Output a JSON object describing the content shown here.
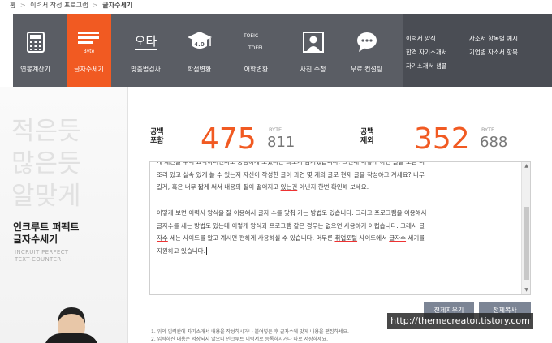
{
  "breadcrumb": [
    "홈",
    "이력서 작성 프로그램",
    "글자수세기"
  ],
  "breadcrumb_sep": ">",
  "nav": {
    "items": [
      {
        "label": "연봉계산기",
        "icon": "calculator-icon"
      },
      {
        "label": "글자수세기",
        "icon": "byte-lines-icon",
        "icon_text": "Byte",
        "active": true
      },
      {
        "label": "맞춤법검사",
        "icon": "spellcheck-icon",
        "icon_text": "오타"
      },
      {
        "label": "학점변환",
        "icon": "grad-cap-icon",
        "icon_text": "4.0"
      },
      {
        "label": "어학변환",
        "icon": "toeic-toefl-icon",
        "icon_text_1": "TOEIC",
        "icon_text_2": "TOEFL"
      },
      {
        "label": "사진 수정",
        "icon": "photo-portrait-icon"
      },
      {
        "label": "무료 컨설팅",
        "icon": "chat-bubble-icon"
      }
    ],
    "links": [
      "이력서 양식",
      "합격 자기소개서",
      "자기소개서 샘플",
      "자소서 항목별 예시",
      "기업별 자소서 항목"
    ]
  },
  "left": {
    "phrase": [
      "적은듯",
      "많은듯",
      "알맞게"
    ],
    "title_1": "인크루트 퍼펙트",
    "title_2": "글자수세기",
    "eng_1": "INCRUIT PERFECT",
    "eng_2": "TEXT-COUNTER"
  },
  "counter": {
    "with_space_label_1": "공백",
    "with_space_label_2": "포함",
    "with_space_chars": "475",
    "with_space_bytes": "811",
    "without_space_label_1": "공백",
    "without_space_label_2": "제외",
    "without_space_chars": "352",
    "without_space_bytes": "688",
    "byte_unit": "BYTE"
  },
  "textarea": {
    "para1_line1": "게 제한을 두어 요약하려면서도 풍성하게 보겠다는 의도가 담겨있습니다. 그런데 어떻게 하면 글을 조금 더",
    "para1_line2": "조리 있고 실속 있게 쓸 수 있는지 자신이 작성한 글이 과연 몇 개의 글로 현재 글을 작성하고 계세요? 너무",
    "para1_line3a": "길게, 혹은 너무 짧게 써서 내용의 질이 떨어지고 ",
    "para1_line3b": "있는건",
    "para1_line3c": " 아닌지 한번 확인해 보세요.",
    "para2_line1": "어떻게 보면 이력서 양식을 잘 이용해서 글자 수를 맞춰 가는 방법도 있습니다.  그리고 프로그램을 이용해서",
    "para2_line2a": "",
    "para2_line2b": "글자수를",
    "para2_line2c": " 세는 방법도 있는데 이렇게 양식과 프로그램 같은 경우는 없으면 사용하기 어렵습니다. 그래서 ",
    "para2_line2d": "글",
    "para2_line3a": "자수",
    "para2_line3b": " 세는 사이트를 알고 계시면 편하게 사용하실 수 있습니다. 머무른 ",
    "para2_line3c": "취업포털",
    "para2_line3d": " 사이트에서 ",
    "para2_line3e": "글자수",
    "para2_line3f": " 세기를",
    "para2_line4": "지원하고 있습니다."
  },
  "buttons": {
    "clear": "전체지우기",
    "copy": "전체복사"
  },
  "notes": [
    "1. 위의 입력칸에 자기소개서 내용을 작성하시거나 붙여넣은 후 글자수에 맞게 내용을 편집하세요.",
    "2. 입력하신 내용은 저장되지 않으니 인크루트 이력서로 등록하시거나 따로 저장하세요."
  ],
  "watermark": "http://themecreator.tistory.com",
  "colors": {
    "accent": "#f15a22",
    "nav_bg": "#5a5d64",
    "button": "#7c8595"
  }
}
